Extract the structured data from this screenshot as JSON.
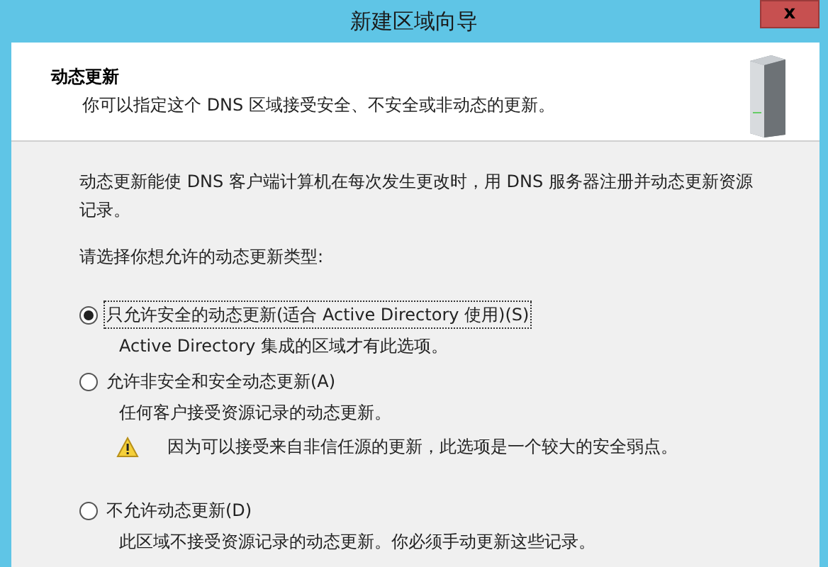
{
  "window": {
    "title": "新建区域向导",
    "close": "x"
  },
  "header": {
    "title": "动态更新",
    "subtitle": "你可以指定这个 DNS 区域接受安全、不安全或非动态的更新。"
  },
  "intro": "动态更新能使 DNS 客户端计算机在每次发生更改时，用 DNS 服务器注册并动态更新资源记录。",
  "prompt": "请选择你想允许的动态更新类型:",
  "options": [
    {
      "label": "只允许安全的动态更新(适合 Active Directory 使用)(S)",
      "selected": true,
      "focused": true,
      "description": "Active Directory 集成的区域才有此选项。"
    },
    {
      "label": "允许非安全和安全动态更新(A)",
      "selected": false,
      "focused": false,
      "description": "任何客户接受资源记录的动态更新。",
      "warning": "因为可以接受来自非信任源的更新，此选项是一个较大的安全弱点。"
    },
    {
      "label": "不允许动态更新(D)",
      "selected": false,
      "focused": false,
      "description": "此区域不接受资源记录的动态更新。你必须手动更新这些记录。"
    }
  ]
}
